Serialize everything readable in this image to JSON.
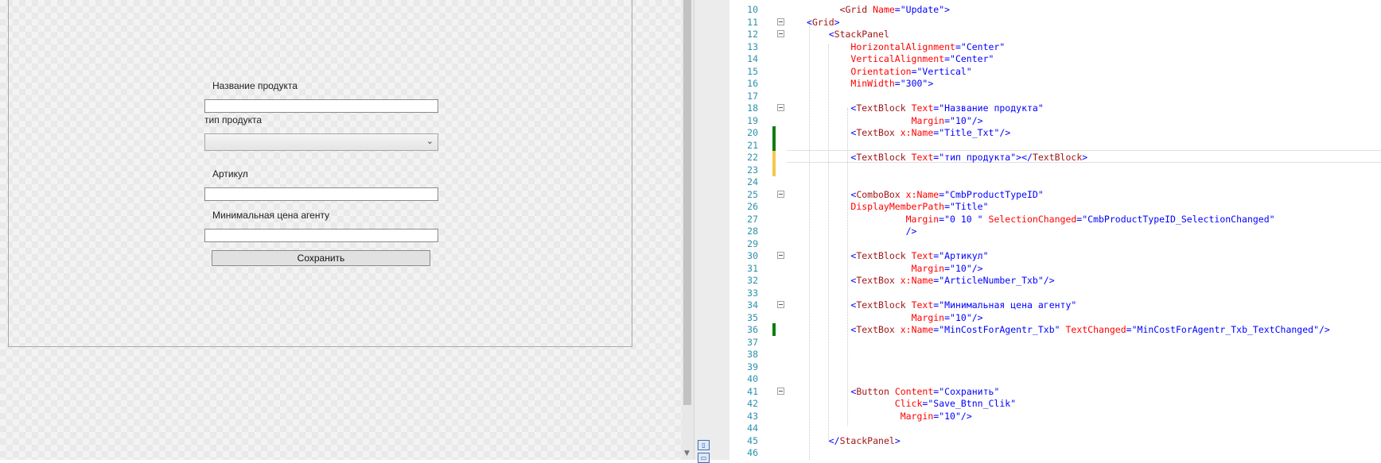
{
  "designer": {
    "form": {
      "label_title": "Название продукта",
      "label_type": "тип продукта",
      "label_article": "Артикул",
      "label_mincost": "Минимальная цена агенту",
      "title_value": "",
      "type_value": "",
      "article_value": "",
      "mincost_value": "",
      "save_label": "Сохранить"
    }
  },
  "colors": {
    "tag": "#a31515",
    "attr": "#ff0000",
    "value": "#0000ff",
    "line_number": "#2b91af",
    "change_saved": "#107c10",
    "change_unsaved": "#f2c94c"
  },
  "editor": {
    "lines": [
      {
        "num": "10",
        "change": "",
        "fold": false,
        "tokens": [
          [
            "tag",
            "      <Grid"
          ],
          [
            "attr",
            " Name"
          ],
          [
            "brk",
            "="
          ],
          [
            "val",
            "\"Update\""
          ],
          [
            "brk",
            ">"
          ]
        ]
      },
      {
        "num": "11",
        "change": "",
        "fold": true,
        "tokens": [
          [
            "brk",
            "<"
          ],
          [
            "tag",
            "Grid"
          ],
          [
            "brk",
            ">"
          ]
        ]
      },
      {
        "num": "12",
        "change": "",
        "fold": true,
        "tokens": [
          [
            "txt",
            "    "
          ],
          [
            "brk",
            "<"
          ],
          [
            "tag",
            "StackPanel"
          ]
        ]
      },
      {
        "num": "13",
        "change": "",
        "fold": false,
        "tokens": [
          [
            "txt",
            "        "
          ],
          [
            "attr",
            "HorizontalAlignment"
          ],
          [
            "brk",
            "="
          ],
          [
            "val",
            "\"Center\""
          ]
        ]
      },
      {
        "num": "14",
        "change": "",
        "fold": false,
        "tokens": [
          [
            "txt",
            "        "
          ],
          [
            "attr",
            "VerticalAlignment"
          ],
          [
            "brk",
            "="
          ],
          [
            "val",
            "\"Center\""
          ]
        ]
      },
      {
        "num": "15",
        "change": "",
        "fold": false,
        "tokens": [
          [
            "txt",
            "        "
          ],
          [
            "attr",
            "Orientation"
          ],
          [
            "brk",
            "="
          ],
          [
            "val",
            "\"Vertical\""
          ]
        ]
      },
      {
        "num": "16",
        "change": "",
        "fold": false,
        "tokens": [
          [
            "txt",
            "        "
          ],
          [
            "attr",
            "MinWidth"
          ],
          [
            "brk",
            "="
          ],
          [
            "val",
            "\"300\""
          ],
          [
            "brk",
            ">"
          ]
        ]
      },
      {
        "num": "17",
        "change": "",
        "fold": false,
        "tokens": []
      },
      {
        "num": "18",
        "change": "",
        "fold": true,
        "tokens": [
          [
            "txt",
            "        "
          ],
          [
            "brk",
            "<"
          ],
          [
            "tag",
            "TextBlock"
          ],
          [
            "txt",
            " "
          ],
          [
            "attr",
            "Text"
          ],
          [
            "brk",
            "="
          ],
          [
            "val",
            "\"Название продукта\""
          ]
        ]
      },
      {
        "num": "19",
        "change": "",
        "fold": false,
        "tokens": [
          [
            "txt",
            "                   "
          ],
          [
            "attr",
            "Margin"
          ],
          [
            "brk",
            "="
          ],
          [
            "val",
            "\"10\""
          ],
          [
            "brk",
            "/>"
          ]
        ]
      },
      {
        "num": "20",
        "change": "saved",
        "fold": false,
        "tokens": [
          [
            "txt",
            "        "
          ],
          [
            "brk",
            "<"
          ],
          [
            "tag",
            "TextBox"
          ],
          [
            "txt",
            " "
          ],
          [
            "attr",
            "x:Name"
          ],
          [
            "brk",
            "="
          ],
          [
            "val",
            "\"Title_Txt\""
          ],
          [
            "brk",
            "/>"
          ]
        ]
      },
      {
        "num": "21",
        "change": "saved",
        "fold": false,
        "tokens": []
      },
      {
        "num": "22",
        "change": "unsaved",
        "fold": false,
        "tokens": [
          [
            "txt",
            "        "
          ],
          [
            "brk",
            "<"
          ],
          [
            "tag",
            "TextBlock"
          ],
          [
            "txt",
            " "
          ],
          [
            "attr",
            "Text"
          ],
          [
            "brk",
            "="
          ],
          [
            "val",
            "\"тип продукта\""
          ],
          [
            "brk",
            "></"
          ],
          [
            "tag",
            "TextBlock"
          ],
          [
            "brk",
            ">"
          ]
        ]
      },
      {
        "num": "23",
        "change": "unsaved",
        "fold": false,
        "tokens": []
      },
      {
        "num": "24",
        "change": "",
        "fold": false,
        "tokens": []
      },
      {
        "num": "25",
        "change": "",
        "fold": true,
        "tokens": [
          [
            "txt",
            "        "
          ],
          [
            "brk",
            "<"
          ],
          [
            "tag",
            "ComboBox"
          ],
          [
            "txt",
            " "
          ],
          [
            "attr",
            "x:Name"
          ],
          [
            "brk",
            "="
          ],
          [
            "val",
            "\"CmbProductTypeID\""
          ]
        ]
      },
      {
        "num": "26",
        "change": "",
        "fold": false,
        "tokens": [
          [
            "txt",
            "        "
          ],
          [
            "attr",
            "DisplayMemberPath"
          ],
          [
            "brk",
            "="
          ],
          [
            "val",
            "\"Title\""
          ]
        ]
      },
      {
        "num": "27",
        "change": "",
        "fold": false,
        "tokens": [
          [
            "txt",
            "                  "
          ],
          [
            "attr",
            "Margin"
          ],
          [
            "brk",
            "="
          ],
          [
            "val",
            "\"0 10 \""
          ],
          [
            "txt",
            " "
          ],
          [
            "attr",
            "SelectionChanged"
          ],
          [
            "brk",
            "="
          ],
          [
            "val",
            "\"CmbProductTypeID_SelectionChanged\""
          ]
        ]
      },
      {
        "num": "28",
        "change": "",
        "fold": false,
        "tokens": [
          [
            "txt",
            "                  "
          ],
          [
            "brk",
            "/>"
          ]
        ]
      },
      {
        "num": "29",
        "change": "",
        "fold": false,
        "tokens": []
      },
      {
        "num": "30",
        "change": "",
        "fold": true,
        "tokens": [
          [
            "txt",
            "        "
          ],
          [
            "brk",
            "<"
          ],
          [
            "tag",
            "TextBlock"
          ],
          [
            "txt",
            " "
          ],
          [
            "attr",
            "Text"
          ],
          [
            "brk",
            "="
          ],
          [
            "val",
            "\"Артикул\""
          ]
        ]
      },
      {
        "num": "31",
        "change": "",
        "fold": false,
        "tokens": [
          [
            "txt",
            "                   "
          ],
          [
            "attr",
            "Margin"
          ],
          [
            "brk",
            "="
          ],
          [
            "val",
            "\"10\""
          ],
          [
            "brk",
            "/>"
          ]
        ]
      },
      {
        "num": "32",
        "change": "",
        "fold": false,
        "tokens": [
          [
            "txt",
            "        "
          ],
          [
            "brk",
            "<"
          ],
          [
            "tag",
            "TextBox"
          ],
          [
            "txt",
            " "
          ],
          [
            "attr",
            "x:Name"
          ],
          [
            "brk",
            "="
          ],
          [
            "val",
            "\"ArticleNumber_Txb\""
          ],
          [
            "brk",
            "/>"
          ]
        ]
      },
      {
        "num": "33",
        "change": "",
        "fold": false,
        "tokens": []
      },
      {
        "num": "34",
        "change": "",
        "fold": true,
        "tokens": [
          [
            "txt",
            "        "
          ],
          [
            "brk",
            "<"
          ],
          [
            "tag",
            "TextBlock"
          ],
          [
            "txt",
            " "
          ],
          [
            "attr",
            "Text"
          ],
          [
            "brk",
            "="
          ],
          [
            "val",
            "\"Минимальная цена агенту\""
          ]
        ]
      },
      {
        "num": "35",
        "change": "",
        "fold": false,
        "tokens": [
          [
            "txt",
            "                   "
          ],
          [
            "attr",
            "Margin"
          ],
          [
            "brk",
            "="
          ],
          [
            "val",
            "\"10\""
          ],
          [
            "brk",
            "/>"
          ]
        ]
      },
      {
        "num": "36",
        "change": "saved",
        "fold": false,
        "tokens": [
          [
            "txt",
            "        "
          ],
          [
            "brk",
            "<"
          ],
          [
            "tag",
            "TextBox"
          ],
          [
            "txt",
            " "
          ],
          [
            "attr",
            "x:Name"
          ],
          [
            "brk",
            "="
          ],
          [
            "val",
            "\"MinCostForAgentr_Txb\""
          ],
          [
            "txt",
            " "
          ],
          [
            "attr",
            "TextChanged"
          ],
          [
            "brk",
            "="
          ],
          [
            "val",
            "\"MinCostForAgentr_Txb_TextChanged\""
          ],
          [
            "brk",
            "/>"
          ]
        ]
      },
      {
        "num": "37",
        "change": "",
        "fold": false,
        "tokens": []
      },
      {
        "num": "38",
        "change": "",
        "fold": false,
        "tokens": []
      },
      {
        "num": "39",
        "change": "",
        "fold": false,
        "tokens": []
      },
      {
        "num": "40",
        "change": "",
        "fold": false,
        "tokens": []
      },
      {
        "num": "41",
        "change": "",
        "fold": true,
        "tokens": [
          [
            "txt",
            "        "
          ],
          [
            "brk",
            "<"
          ],
          [
            "tag",
            "Button"
          ],
          [
            "txt",
            " "
          ],
          [
            "attr",
            "Content"
          ],
          [
            "brk",
            "="
          ],
          [
            "val",
            "\"Сохранить\""
          ]
        ]
      },
      {
        "num": "42",
        "change": "",
        "fold": false,
        "tokens": [
          [
            "txt",
            "                "
          ],
          [
            "attr",
            "Click"
          ],
          [
            "brk",
            "="
          ],
          [
            "val",
            "\"Save_Btnn_Clik\""
          ]
        ]
      },
      {
        "num": "43",
        "change": "",
        "fold": false,
        "tokens": [
          [
            "txt",
            "                 "
          ],
          [
            "attr",
            "Margin"
          ],
          [
            "brk",
            "="
          ],
          [
            "val",
            "\"10\""
          ],
          [
            "brk",
            "/>"
          ]
        ]
      },
      {
        "num": "44",
        "change": "",
        "fold": false,
        "tokens": []
      },
      {
        "num": "45",
        "change": "",
        "fold": false,
        "tokens": [
          [
            "txt",
            "    "
          ],
          [
            "brk",
            "</"
          ],
          [
            "tag",
            "StackPanel"
          ],
          [
            "brk",
            ">"
          ]
        ]
      },
      {
        "num": "46",
        "change": "",
        "fold": false,
        "tokens": []
      }
    ]
  }
}
